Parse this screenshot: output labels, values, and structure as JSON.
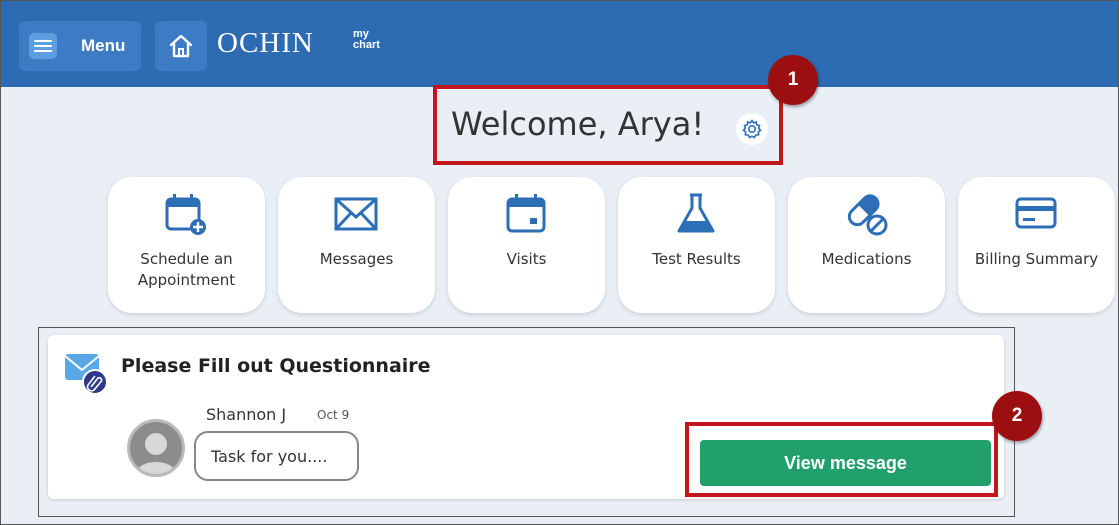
{
  "header": {
    "menu_label": "Menu",
    "logo_text": "OCHIN",
    "logo_sub_line1": "my",
    "logo_sub_line2": "chart"
  },
  "welcome": {
    "text": "Welcome, Arya!"
  },
  "callouts": {
    "badge1": "1",
    "badge2": "2"
  },
  "tiles": [
    {
      "label": "Schedule an Appointment"
    },
    {
      "label": "Messages"
    },
    {
      "label": "Visits"
    },
    {
      "label": "Test Results"
    },
    {
      "label": "Medications"
    },
    {
      "label": "Billing Summary"
    }
  ],
  "message_card": {
    "title": "Please Fill out Questionnaire",
    "sender": "Shannon J",
    "date": "Oct 9",
    "preview": "Task for you....",
    "action_label": "View message"
  },
  "colors": {
    "header_blue": "#2d6cb3",
    "icon_blue": "#2c6fb7",
    "callout_red": "#c0161c",
    "badge_dark_red": "#9c0f10",
    "action_green": "#22a06b"
  },
  "icons": [
    "hamburger-menu-icon",
    "home-icon",
    "gear-icon",
    "calendar-plus-icon",
    "envelope-icon",
    "calendar-icon",
    "flask-icon",
    "pill-icon",
    "credit-card-icon",
    "message-attachment-icon",
    "user-avatar-icon"
  ]
}
